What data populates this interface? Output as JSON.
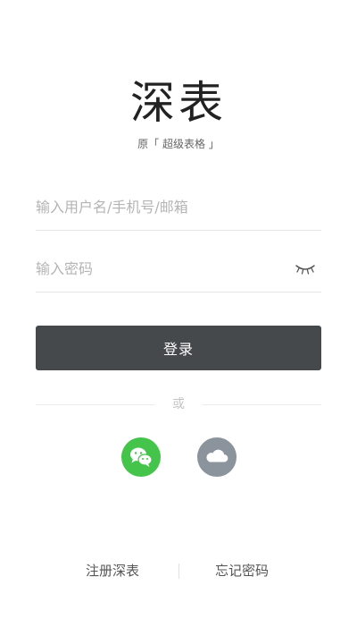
{
  "brand": {
    "logo_text": "深表",
    "tagline": "原「 超级表格 」"
  },
  "login_form": {
    "username_placeholder": "输入用户名/手机号/邮箱",
    "password_placeholder": "输入密码",
    "password_toggle_icon": "eye-closed-icon",
    "login_label": "登录"
  },
  "alt_login": {
    "divider_text": "或",
    "providers": [
      {
        "icon": "wechat-icon",
        "color": "#44c44a"
      },
      {
        "icon": "cloud-icon",
        "color": "#8b939d"
      }
    ]
  },
  "footer": {
    "register_label": "注册深表",
    "forgot_label": "忘记密码"
  },
  "colors": {
    "button_bg": "#45494c",
    "placeholder": "#b4b4b4"
  }
}
